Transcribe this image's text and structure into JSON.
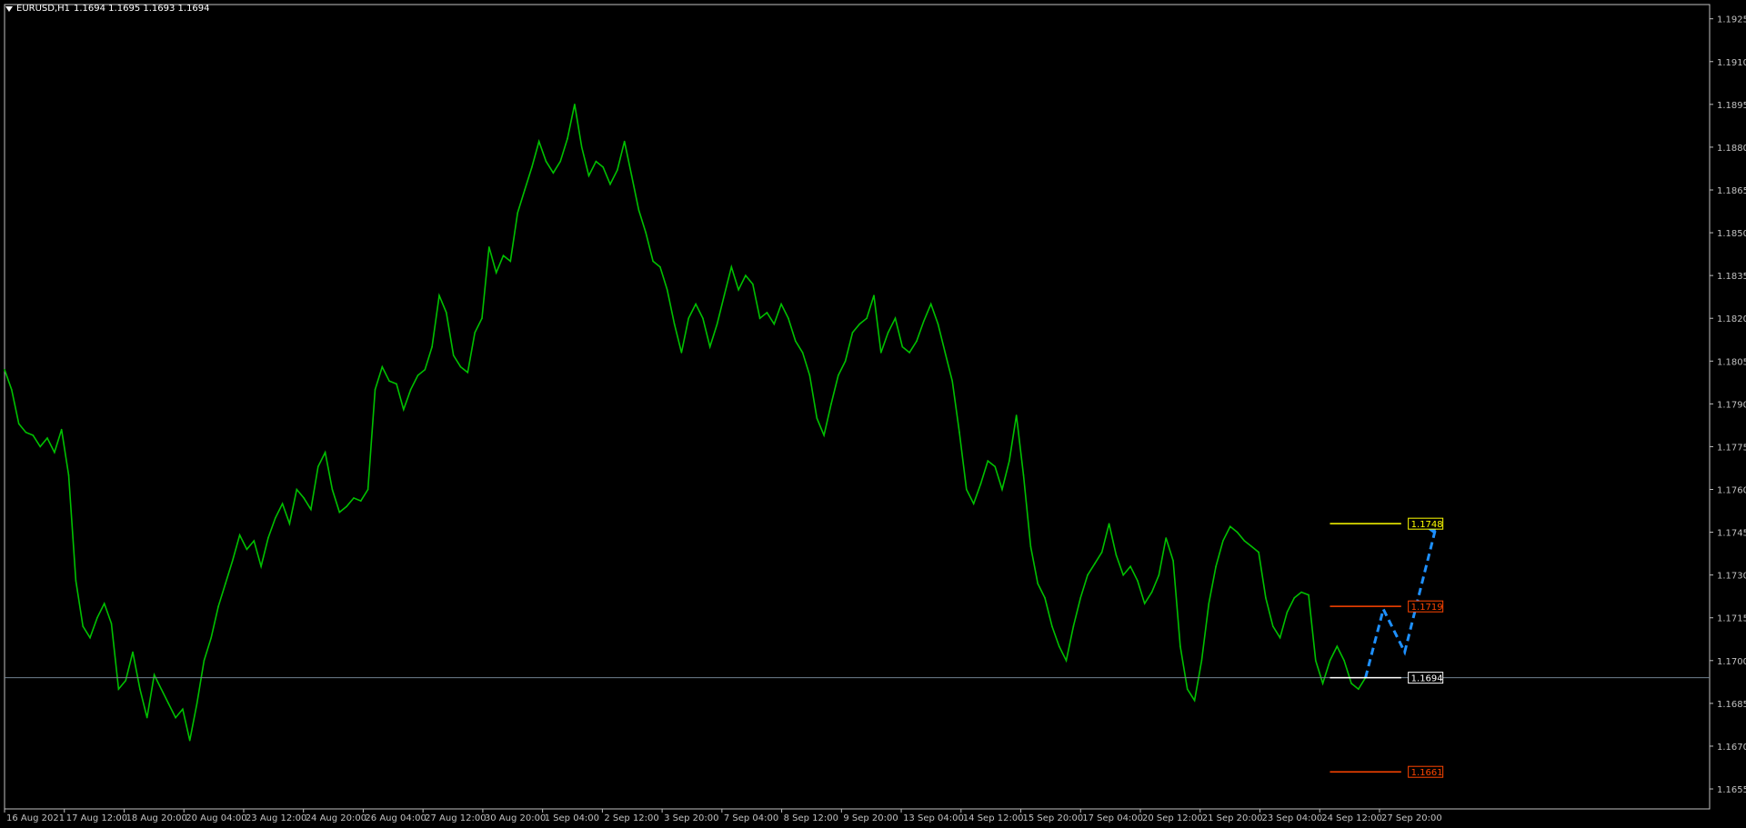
{
  "window": {
    "symbol_title": "EURUSD,H1",
    "ohlc": "1.1694 1.1695 1.1693 1.1694"
  },
  "colors": {
    "background": "#000000",
    "price_line": "#00c000",
    "axis": "#c0c0c0",
    "level_white": "#ffffff",
    "level_red": "#ff4500",
    "level_yellow": "#ffff00",
    "zone": "#1a1a6e",
    "arrow": "#1e90ff",
    "bid_line": "#708090"
  },
  "chart_data": {
    "type": "line",
    "symbol": "EURUSD",
    "timeframe": "H1",
    "ylim": [
      1.1648,
      1.193
    ],
    "y_ticks": [
      "1.1925",
      "1.1910",
      "1.1895",
      "1.1880",
      "1.1865",
      "1.1850",
      "1.1835",
      "1.1820",
      "1.1805",
      "1.1790",
      "1.1775",
      "1.1760",
      "1.1745",
      "1.1730",
      "1.1715",
      "1.1700",
      "1.1685",
      "1.1670",
      "1.1655"
    ],
    "x_ticks": [
      "16 Aug 2021",
      "17 Aug 12:00",
      "18 Aug 20:00",
      "20 Aug 04:00",
      "23 Aug 12:00",
      "24 Aug 20:00",
      "26 Aug 04:00",
      "27 Aug 12:00",
      "30 Aug 20:00",
      "1 Sep 04:00",
      "2 Sep 12:00",
      "3 Sep 20:00",
      "7 Sep 04:00",
      "8 Sep 12:00",
      "9 Sep 20:00",
      "13 Sep 04:00",
      "14 Sep 12:00",
      "15 Sep 20:00",
      "17 Sep 04:00",
      "20 Sep 12:00",
      "21 Sep 20:00",
      "23 Sep 04:00",
      "24 Sep 12:00",
      "27 Sep 20:00"
    ],
    "series": [
      {
        "values": [
          [
            0,
            1.1802
          ],
          [
            1,
            1.1795
          ],
          [
            2,
            1.1783
          ],
          [
            3,
            1.178
          ],
          [
            4,
            1.1779
          ],
          [
            5,
            1.1775
          ],
          [
            6,
            1.1778
          ],
          [
            7,
            1.1773
          ],
          [
            8,
            1.1781
          ],
          [
            9,
            1.1765
          ],
          [
            10,
            1.1728
          ],
          [
            11,
            1.1712
          ],
          [
            12,
            1.1708
          ],
          [
            13,
            1.1715
          ],
          [
            14,
            1.172
          ],
          [
            15,
            1.1713
          ],
          [
            16,
            1.169
          ],
          [
            17,
            1.1693
          ],
          [
            18,
            1.1703
          ],
          [
            19,
            1.169
          ],
          [
            20,
            1.168
          ],
          [
            21,
            1.1695
          ],
          [
            22,
            1.169
          ],
          [
            23,
            1.1685
          ],
          [
            24,
            1.168
          ],
          [
            25,
            1.1683
          ],
          [
            26,
            1.1672
          ],
          [
            27,
            1.1685
          ],
          [
            28,
            1.17
          ],
          [
            29,
            1.1708
          ],
          [
            30,
            1.1719
          ],
          [
            31,
            1.1727
          ],
          [
            32,
            1.1735
          ],
          [
            33,
            1.1744
          ],
          [
            34,
            1.1739
          ],
          [
            35,
            1.1742
          ],
          [
            36,
            1.1733
          ],
          [
            37,
            1.1743
          ],
          [
            38,
            1.175
          ],
          [
            39,
            1.1755
          ],
          [
            40,
            1.1748
          ],
          [
            41,
            1.176
          ],
          [
            42,
            1.1757
          ],
          [
            43,
            1.1753
          ],
          [
            44,
            1.1768
          ],
          [
            45,
            1.1773
          ],
          [
            46,
            1.176
          ],
          [
            47,
            1.1752
          ],
          [
            48,
            1.1754
          ],
          [
            49,
            1.1757
          ],
          [
            50,
            1.1756
          ],
          [
            51,
            1.176
          ],
          [
            52,
            1.1795
          ],
          [
            53,
            1.1803
          ],
          [
            54,
            1.1798
          ],
          [
            55,
            1.1797
          ],
          [
            56,
            1.1788
          ],
          [
            57,
            1.1795
          ],
          [
            58,
            1.18
          ],
          [
            59,
            1.1802
          ],
          [
            60,
            1.181
          ],
          [
            61,
            1.1828
          ],
          [
            62,
            1.1822
          ],
          [
            63,
            1.1807
          ],
          [
            64,
            1.1803
          ],
          [
            65,
            1.1801
          ],
          [
            66,
            1.1815
          ],
          [
            67,
            1.182
          ],
          [
            68,
            1.1845
          ],
          [
            69,
            1.1836
          ],
          [
            70,
            1.1842
          ],
          [
            71,
            1.184
          ],
          [
            72,
            1.1857
          ],
          [
            73,
            1.1865
          ],
          [
            74,
            1.1873
          ],
          [
            75,
            1.1882
          ],
          [
            76,
            1.1875
          ],
          [
            77,
            1.1871
          ],
          [
            78,
            1.1875
          ],
          [
            79,
            1.1883
          ],
          [
            80,
            1.1895
          ],
          [
            81,
            1.188
          ],
          [
            82,
            1.187
          ],
          [
            83,
            1.1875
          ],
          [
            84,
            1.1873
          ],
          [
            85,
            1.1867
          ],
          [
            86,
            1.1872
          ],
          [
            87,
            1.1882
          ],
          [
            88,
            1.187
          ],
          [
            89,
            1.1858
          ],
          [
            90,
            1.185
          ],
          [
            91,
            1.184
          ],
          [
            92,
            1.1838
          ],
          [
            93,
            1.183
          ],
          [
            94,
            1.1818
          ],
          [
            95,
            1.1808
          ],
          [
            96,
            1.182
          ],
          [
            97,
            1.1825
          ],
          [
            98,
            1.182
          ],
          [
            99,
            1.181
          ],
          [
            100,
            1.1818
          ],
          [
            101,
            1.1828
          ],
          [
            102,
            1.1838
          ],
          [
            103,
            1.183
          ],
          [
            104,
            1.1835
          ],
          [
            105,
            1.1832
          ],
          [
            106,
            1.182
          ],
          [
            107,
            1.1822
          ],
          [
            108,
            1.1818
          ],
          [
            109,
            1.1825
          ],
          [
            110,
            1.182
          ],
          [
            111,
            1.1812
          ],
          [
            112,
            1.1808
          ],
          [
            113,
            1.18
          ],
          [
            114,
            1.1785
          ],
          [
            115,
            1.1779
          ],
          [
            116,
            1.179
          ],
          [
            117,
            1.18
          ],
          [
            118,
            1.1805
          ],
          [
            119,
            1.1815
          ],
          [
            120,
            1.1818
          ],
          [
            121,
            1.182
          ],
          [
            122,
            1.1828
          ],
          [
            123,
            1.1808
          ],
          [
            124,
            1.1815
          ],
          [
            125,
            1.182
          ],
          [
            126,
            1.181
          ],
          [
            127,
            1.1808
          ],
          [
            128,
            1.1812
          ],
          [
            129,
            1.1819
          ],
          [
            130,
            1.1825
          ],
          [
            131,
            1.1818
          ],
          [
            132,
            1.1808
          ],
          [
            133,
            1.1798
          ],
          [
            134,
            1.178
          ],
          [
            135,
            1.176
          ],
          [
            136,
            1.1755
          ],
          [
            137,
            1.1762
          ],
          [
            138,
            1.177
          ],
          [
            139,
            1.1768
          ],
          [
            140,
            1.176
          ],
          [
            141,
            1.177
          ],
          [
            142,
            1.1786
          ],
          [
            143,
            1.1765
          ],
          [
            144,
            1.174
          ],
          [
            145,
            1.1727
          ],
          [
            146,
            1.1722
          ],
          [
            147,
            1.1712
          ],
          [
            148,
            1.1705
          ],
          [
            149,
            1.17
          ],
          [
            150,
            1.1712
          ],
          [
            151,
            1.1722
          ],
          [
            152,
            1.173
          ],
          [
            153,
            1.1734
          ],
          [
            154,
            1.1738
          ],
          [
            155,
            1.1748
          ],
          [
            156,
            1.1737
          ],
          [
            157,
            1.173
          ],
          [
            158,
            1.1733
          ],
          [
            159,
            1.1728
          ],
          [
            160,
            1.172
          ],
          [
            161,
            1.1724
          ],
          [
            162,
            1.173
          ],
          [
            163,
            1.1743
          ],
          [
            164,
            1.1735
          ],
          [
            165,
            1.1705
          ],
          [
            166,
            1.169
          ],
          [
            167,
            1.1686
          ],
          [
            168,
            1.17
          ],
          [
            169,
            1.172
          ],
          [
            170,
            1.1733
          ],
          [
            171,
            1.1742
          ],
          [
            172,
            1.1747
          ],
          [
            173,
            1.1745
          ],
          [
            174,
            1.1742
          ],
          [
            175,
            1.174
          ],
          [
            176,
            1.1738
          ],
          [
            177,
            1.1722
          ],
          [
            178,
            1.1712
          ],
          [
            179,
            1.1708
          ],
          [
            180,
            1.1717
          ],
          [
            181,
            1.1722
          ],
          [
            182,
            1.1724
          ],
          [
            183,
            1.1723
          ],
          [
            184,
            1.17
          ],
          [
            185,
            1.1692
          ],
          [
            186,
            1.17
          ],
          [
            187,
            1.1705
          ],
          [
            188,
            1.17
          ],
          [
            189,
            1.1692
          ],
          [
            190,
            1.169
          ],
          [
            191,
            1.1694
          ]
        ]
      }
    ],
    "annotations": {
      "price_labels": [
        {
          "text": "1.1748",
          "price": 1.1748,
          "color": "#ffff00"
        },
        {
          "text": "1.1719",
          "price": 1.1719,
          "color": "#ff4500"
        },
        {
          "text": "1.1694",
          "price": 1.1694,
          "color": "#ffffff"
        },
        {
          "text": "1.1661",
          "price": 1.1661,
          "color": "#ff4500"
        }
      ],
      "forecast_arrow": [
        [
          191,
          1.1694
        ],
        [
          193.5,
          1.1718
        ],
        [
          196.5,
          1.1703
        ],
        [
          201,
          1.1748
        ]
      ]
    }
  }
}
